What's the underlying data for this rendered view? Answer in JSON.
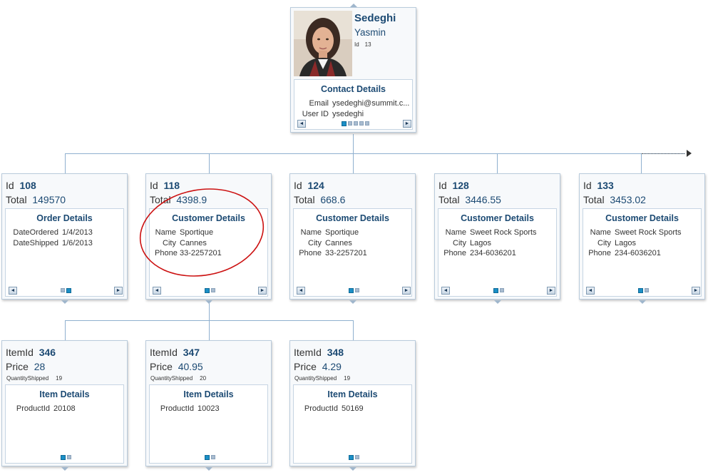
{
  "root": {
    "last_name": "Sedeghi",
    "first_name": "Yasmin",
    "id_label": "Id",
    "id_value": "13",
    "panel_title": "Contact Details",
    "rows": [
      {
        "k": "Email",
        "v": "ysedeghi@summit.c..."
      },
      {
        "k": "User ID",
        "v": "ysedeghi"
      }
    ],
    "nav_prev": "◄",
    "nav_next": "►"
  },
  "orders": [
    {
      "id_label": "Id",
      "id_value": "108",
      "total_label": "Total",
      "total_value": "149570",
      "panel_title": "Order Details",
      "rows": [
        {
          "k": "DateOrdered",
          "v": "1/4/2013"
        },
        {
          "k": "DateShipped",
          "v": "1/6/2013"
        }
      ]
    },
    {
      "id_label": "Id",
      "id_value": "118",
      "total_label": "Total",
      "total_value": "4398.9",
      "panel_title": "Customer Details",
      "rows": [
        {
          "k": "Name",
          "v": "Sportique"
        },
        {
          "k": "City",
          "v": "Cannes"
        },
        {
          "k": "Phone",
          "v": "33-2257201"
        }
      ]
    },
    {
      "id_label": "Id",
      "id_value": "124",
      "total_label": "Total",
      "total_value": "668.6",
      "panel_title": "Customer Details",
      "rows": [
        {
          "k": "Name",
          "v": "Sportique"
        },
        {
          "k": "City",
          "v": "Cannes"
        },
        {
          "k": "Phone",
          "v": "33-2257201"
        }
      ]
    },
    {
      "id_label": "Id",
      "id_value": "128",
      "total_label": "Total",
      "total_value": "3446.55",
      "panel_title": "Customer Details",
      "rows": [
        {
          "k": "Name",
          "v": "Sweet Rock Sports"
        },
        {
          "k": "City",
          "v": "Lagos"
        },
        {
          "k": "Phone",
          "v": "234-6036201"
        }
      ]
    },
    {
      "id_label": "Id",
      "id_value": "133",
      "total_label": "Total",
      "total_value": "3453.02",
      "panel_title": "Customer Details",
      "rows": [
        {
          "k": "Name",
          "v": "Sweet Rock Sports"
        },
        {
          "k": "City",
          "v": "Lagos"
        },
        {
          "k": "Phone",
          "v": "234-6036201"
        }
      ]
    }
  ],
  "items": [
    {
      "id_label": "ItemId",
      "id_value": "346",
      "price_label": "Price",
      "price_value": "28",
      "qty_label": "QuantityShipped",
      "qty_value": "19",
      "panel_title": "Item Details",
      "rows": [
        {
          "k": "ProductId",
          "v": "20108"
        }
      ]
    },
    {
      "id_label": "ItemId",
      "id_value": "347",
      "price_label": "Price",
      "price_value": "40.95",
      "qty_label": "QuantityShipped",
      "qty_value": "20",
      "panel_title": "Item Details",
      "rows": [
        {
          "k": "ProductId",
          "v": "10023"
        }
      ]
    },
    {
      "id_label": "ItemId",
      "id_value": "348",
      "price_label": "Price",
      "price_value": "4.29",
      "qty_label": "QuantityShipped",
      "qty_value": "19",
      "panel_title": "Item Details",
      "rows": [
        {
          "k": "ProductId",
          "v": "50169"
        }
      ]
    }
  ],
  "colors": {
    "accent": "#1b8fc6",
    "title": "#1c4a73",
    "connector": "#8fb0cf",
    "highlight_circle": "#cc1111"
  },
  "icons": [
    "person-photo",
    "nav-left-arrow-icon",
    "nav-right-arrow-icon",
    "more-siblings-arrow-icon"
  ]
}
